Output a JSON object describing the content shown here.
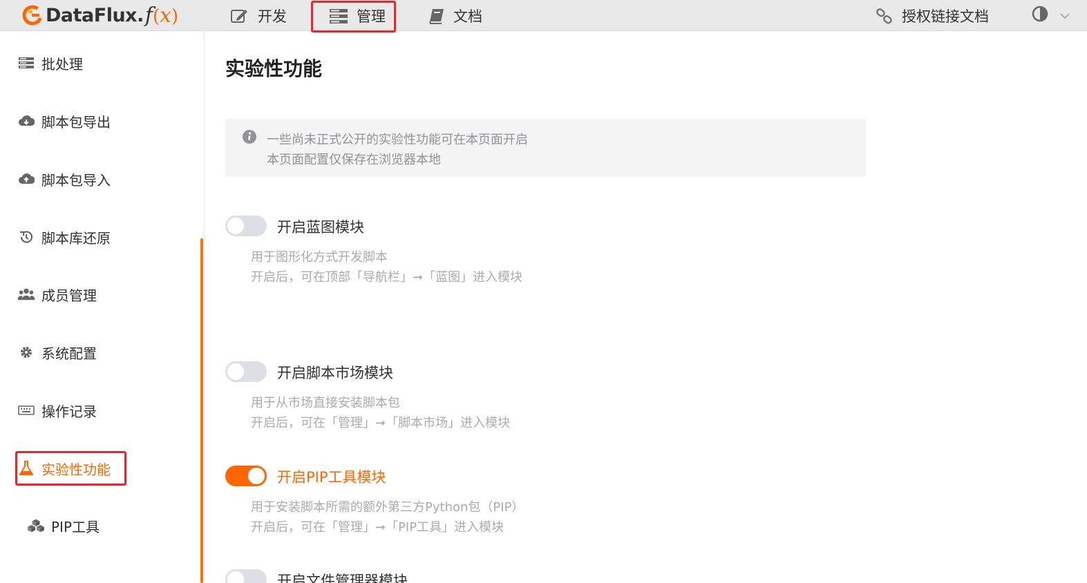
{
  "header": {
    "logo_text": "DataFlux.",
    "logo_fx_f": "f",
    "logo_fx_open": "(",
    "logo_fx_x": "x",
    "logo_fx_close": ")",
    "nav": {
      "dev": "开发",
      "manage": "管理",
      "docs": "文档",
      "auth_docs": "授权链接文档"
    }
  },
  "sidebar": {
    "items": [
      {
        "label": "批处理",
        "icon": "list-icon"
      },
      {
        "label": "脚本包导出",
        "icon": "cloud-download-icon"
      },
      {
        "label": "脚本包导入",
        "icon": "cloud-upload-icon"
      },
      {
        "label": "脚本库还原",
        "icon": "history-icon"
      },
      {
        "label": "成员管理",
        "icon": "users-icon"
      },
      {
        "label": "系统配置",
        "icon": "gear-icon"
      },
      {
        "label": "操作记录",
        "icon": "keyboard-icon"
      },
      {
        "label": "实验性功能",
        "icon": "flask-icon"
      },
      {
        "label": "PIP工具",
        "icon": "cubes-icon"
      }
    ]
  },
  "main": {
    "title": "实验性功能",
    "info": {
      "line1": "一些尚未正式公开的实验性功能可在本页面开启",
      "line2": "本页面配置仅保存在浏览器本地"
    },
    "features": [
      {
        "label": "开启蓝图模块",
        "enabled": false,
        "desc1": "用于图形化方式开发脚本",
        "desc2": "开启后，可在顶部「导航栏」➞「蓝图」进入模块"
      },
      {
        "label": "开启脚本市场模块",
        "enabled": false,
        "desc1": "用于从市场直接安装脚本包",
        "desc2": "开启后，可在「管理」➞「脚本市场」进入模块"
      },
      {
        "label": "开启PIP工具模块",
        "enabled": true,
        "desc1": "用于安装脚本所需的额外第三方Python包（PIP）",
        "desc2": "开启后，可在「管理」➞「PIP工具」进入模块"
      },
      {
        "label": "开启文件管理器模块",
        "enabled": false
      }
    ]
  },
  "colors": {
    "accent": "#ff6600",
    "highlight": "#e8262a"
  }
}
